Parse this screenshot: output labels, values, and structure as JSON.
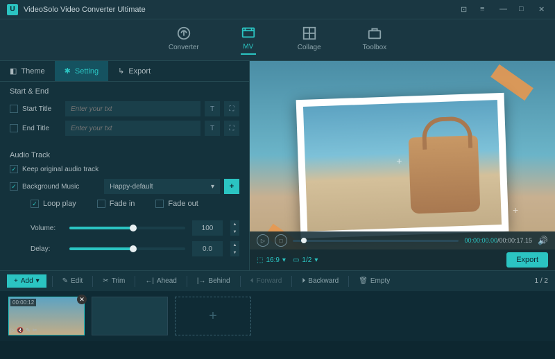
{
  "app": {
    "title": "VideoSolo Video Converter Ultimate"
  },
  "nav": {
    "converter": "Converter",
    "mv": "MV",
    "collage": "Collage",
    "toolbox": "Toolbox"
  },
  "subtabs": {
    "theme": "Theme",
    "setting": "Setting",
    "export": "Export"
  },
  "sections": {
    "startend": "Start & End",
    "startTitle": "Start Title",
    "endTitle": "End Title",
    "placeholder": "Enter your txt",
    "audio": "Audio Track",
    "keepOriginal": "Keep original audio track",
    "bgMusic": "Background Music",
    "bgMusicValue": "Happy-default",
    "loopPlay": "Loop play",
    "fadeIn": "Fade in",
    "fadeOut": "Fade out",
    "volume": "Volume:",
    "volumeValue": "100",
    "delay": "Delay:",
    "delayValue": "0.0"
  },
  "playback": {
    "current": "00:00:00.00",
    "total": "/00:00:17.15",
    "aspect": "16:9",
    "page": "1/2"
  },
  "export": "Export",
  "toolbar": {
    "add": "Add",
    "edit": "Edit",
    "trim": "Trim",
    "ahead": "Ahead",
    "behind": "Behind",
    "forward": "Forward",
    "backward": "Backward",
    "empty": "Empty",
    "pager": "1 / 2"
  },
  "thumb": {
    "time": "00:00:12"
  }
}
